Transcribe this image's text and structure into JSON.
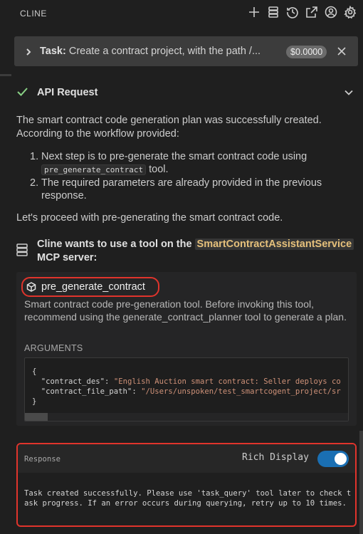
{
  "header": {
    "title": "CLINE",
    "icons": [
      "plus-icon",
      "server-icon",
      "history-icon",
      "external-link-icon",
      "account-icon",
      "settings-icon"
    ]
  },
  "task": {
    "prefix": "Task:",
    "text": " Create a contract project, with the path /...",
    "cost": "$0.0000"
  },
  "api_request": {
    "label": "API Request",
    "status_color": "#89d185"
  },
  "message": {
    "intro": "The smart contract code generation plan was successfully created. According to the workflow provided:",
    "steps": [
      {
        "num": "1.",
        "text_before": "Next step is to pre-generate the smart contract code using ",
        "code": "pre_generate_contract",
        "text_after": " tool."
      },
      {
        "num": "2.",
        "text": "The required parameters are already provided in the previous response."
      }
    ],
    "outro": "Let's proceed with pre-generating the smart contract code."
  },
  "tool_use": {
    "heading_before": "Cline wants to use a tool on the ",
    "server_name": "SmartContractAssistantService",
    "heading_after": " MCP server:",
    "tool_name": "pre_generate_contract",
    "description": "Smart contract code pre-generation tool. Before invoking this tool, recommend using the generate_contract_planner tool to generate a plan.",
    "arguments_label": "ARGUMENTS",
    "arguments": {
      "open": "{",
      "key1": "  \"contract_des\": ",
      "val1": "\"English Auction smart contract: Seller deploys co",
      "key2": "  \"contract_file_path\": ",
      "val2": "\"/Users/unspoken/test_smartcogent_project/sr",
      "close": "}"
    }
  },
  "response": {
    "label": "Response",
    "rich_display_label": "Rich Display",
    "rich_display_on": true,
    "text": "Task created successfully. Please use 'task_query' tool later to check task progress. If an error occurs during querying, retry up to 10 times."
  },
  "colors": {
    "highlight_border": "#e0342c",
    "toggle": "#1a6fb3",
    "server_name": "#e5c07b"
  }
}
